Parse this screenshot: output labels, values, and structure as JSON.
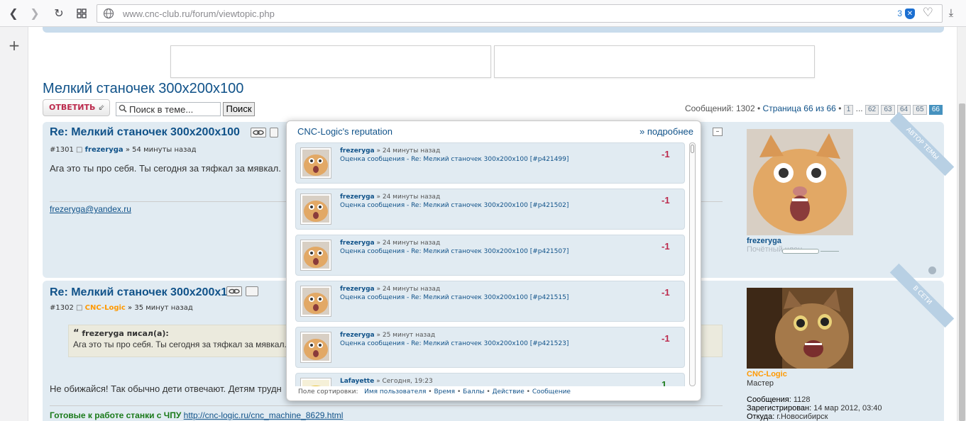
{
  "browser": {
    "url": "www.cnc-club.ru/forum/viewtopic.php",
    "tracker_count": "3"
  },
  "topic": {
    "title": "Мелкий станочек 300x200x100",
    "reply_label": "ОТВЕТИТЬ",
    "search_placeholder": "Поиск в теме...",
    "search_button": "Поиск",
    "messages_label": "Сообщений: 1302",
    "bullet": "•",
    "page_label": "Страница 66 из 66",
    "ellipsis": "...",
    "pages": [
      "1",
      "62",
      "63",
      "64",
      "65",
      "66"
    ]
  },
  "posts": [
    {
      "title": "Re: Мелкий станочек 300x200x100",
      "number": "#1301",
      "author": "frezeryga",
      "time": "» 54 минуты назад",
      "body": "Ага это ты про себя. Ты сегодня за тяфкал за мявкал.",
      "email": "frezeryga@yandex.ru",
      "profile": {
        "name": "frezeryga",
        "rank": "Почётный член",
        "ribbon": "АВТОР ТЕМЫ"
      }
    },
    {
      "title": "Re: Мелкий станочек 300x200x100",
      "number": "#1302",
      "author": "CNC-Logic",
      "time": "» 35 минут назад",
      "quote_author": "frezeryga писал(а):",
      "quote_text": "Ага это ты про себя. Ты сегодня за тяфкал за мявкал.",
      "body": "Не обижайся! Так обычно дети отвечают. Детям трудн",
      "signature_text": "Готовые к работе станки с ЧПУ",
      "signature_link": "http://cnc-logic.ru/cnc_machine_8629.html",
      "profile": {
        "name": "CNC-Logic",
        "rank": "Мастер",
        "ribbon": "В СЕТИ",
        "messages_label": "Сообщения:",
        "messages_value": "1128",
        "registered_label": "Зарегистрирован:",
        "registered_value": "14 мар 2012, 03:40",
        "from_label": "Откуда:",
        "from_value": "г.Новосибирск"
      }
    }
  ],
  "reputation": {
    "title": "CNC-Logic's reputation",
    "more": "» подробнее",
    "items": [
      {
        "user": "frezeryga",
        "time": "» 24 минуты назад",
        "desc": "Оценка сообщения - Re: Мелкий станочек 300x200x100 [#p421499]",
        "score": "-1"
      },
      {
        "user": "frezeryga",
        "time": "» 24 минуты назад",
        "desc": "Оценка сообщения - Re: Мелкий станочек 300x200x100 [#p421502]",
        "score": "-1"
      },
      {
        "user": "frezeryga",
        "time": "» 24 минуты назад",
        "desc": "Оценка сообщения - Re: Мелкий станочек 300x200x100 [#p421507]",
        "score": "-1"
      },
      {
        "user": "frezeryga",
        "time": "» 24 минуты назад",
        "desc": "Оценка сообщения - Re: Мелкий станочек 300x200x100 [#p421515]",
        "score": "-1"
      },
      {
        "user": "frezeryga",
        "time": "» 25 минут назад",
        "desc": "Оценка сообщения - Re: Мелкий станочек 300x200x100 [#p421523]",
        "score": "-1"
      },
      {
        "user": "Lafayette",
        "time": "» Сегодня, 19:23",
        "desc": "",
        "score": "1"
      }
    ],
    "sort": {
      "label": "Поле сортировки:",
      "options": [
        "Имя пользователя",
        "Время",
        "Баллы",
        "Действие",
        "Сообщение"
      ]
    }
  }
}
